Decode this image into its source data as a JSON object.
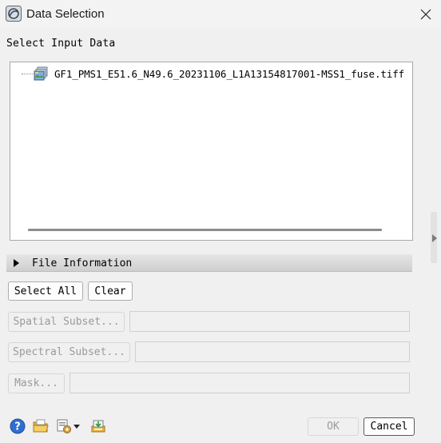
{
  "window": {
    "title": "Data Selection",
    "close_glyph": "✕"
  },
  "input": {
    "section_label": "Select Input Data",
    "file_name": "GF1_PMS1_E51.6_N49.6_20231106_L1A13154817001-MSS1_fuse.tiff"
  },
  "file_information": {
    "label": "File Information"
  },
  "buttons": {
    "select_all": "Select All",
    "clear": "Clear",
    "spatial_subset": "Spatial Subset...",
    "spectral_subset": "Spectral Subset...",
    "mask": "Mask...",
    "ok": "OK",
    "cancel": "Cancel"
  },
  "icons": {
    "app": "envi-app-icon",
    "help": "help-icon",
    "open": "open-folder-icon",
    "options": "options-dropdown-icon",
    "export": "export-icon"
  },
  "colors": {
    "help_blue": "#2f6fd0",
    "folder_yellow": "#e9b43a"
  }
}
